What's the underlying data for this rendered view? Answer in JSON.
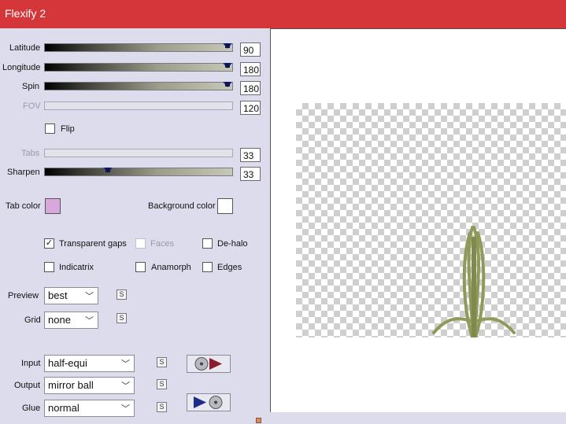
{
  "window": {
    "title": "Flexify 2",
    "titlebar_color": "#d4363a"
  },
  "sliders": [
    {
      "label": "Latitude",
      "value": "90",
      "level": 1.0,
      "disabled": false
    },
    {
      "label": "Longitude",
      "value": "180",
      "level": 1.0,
      "disabled": false
    },
    {
      "label": "Spin",
      "value": "180",
      "level": 1.0,
      "disabled": false
    },
    {
      "label": "FOV",
      "value": "120",
      "level": 0.0,
      "disabled": true
    }
  ],
  "flip": {
    "label": "Flip",
    "checked": false
  },
  "tabs": {
    "label": "Tabs",
    "value": "33",
    "disabled": true
  },
  "sharpen": {
    "label": "Sharpen",
    "value": "33",
    "level": 0.33
  },
  "colors": {
    "tab_label": "Tab color",
    "tab_color": "#d8a8dc",
    "background_label": "Background color",
    "background_color": "#ffffff"
  },
  "checkboxes": {
    "transparent_gaps": {
      "label": "Transparent gaps",
      "checked": true
    },
    "faces": {
      "label": "Faces",
      "checked": false,
      "disabled": true
    },
    "de_halo": {
      "label": "De-halo",
      "checked": false
    },
    "indicatrix": {
      "label": "Indicatrix",
      "checked": false
    },
    "anamorph": {
      "label": "Anamorph",
      "checked": false
    },
    "edges": {
      "label": "Edges",
      "checked": false
    }
  },
  "preview": {
    "label": "Preview",
    "value": "best"
  },
  "grid": {
    "label": "Grid",
    "value": "none"
  },
  "input": {
    "label": "Input",
    "value": "half-equi"
  },
  "output": {
    "label": "Output",
    "value": "mirror ball"
  },
  "glue": {
    "label": "Glue",
    "value": "normal"
  },
  "icons": {
    "lock": "s-lock-icon",
    "dropdown": "chevron-down-icon"
  },
  "preview_art": {
    "color": "#8f9a5a"
  }
}
